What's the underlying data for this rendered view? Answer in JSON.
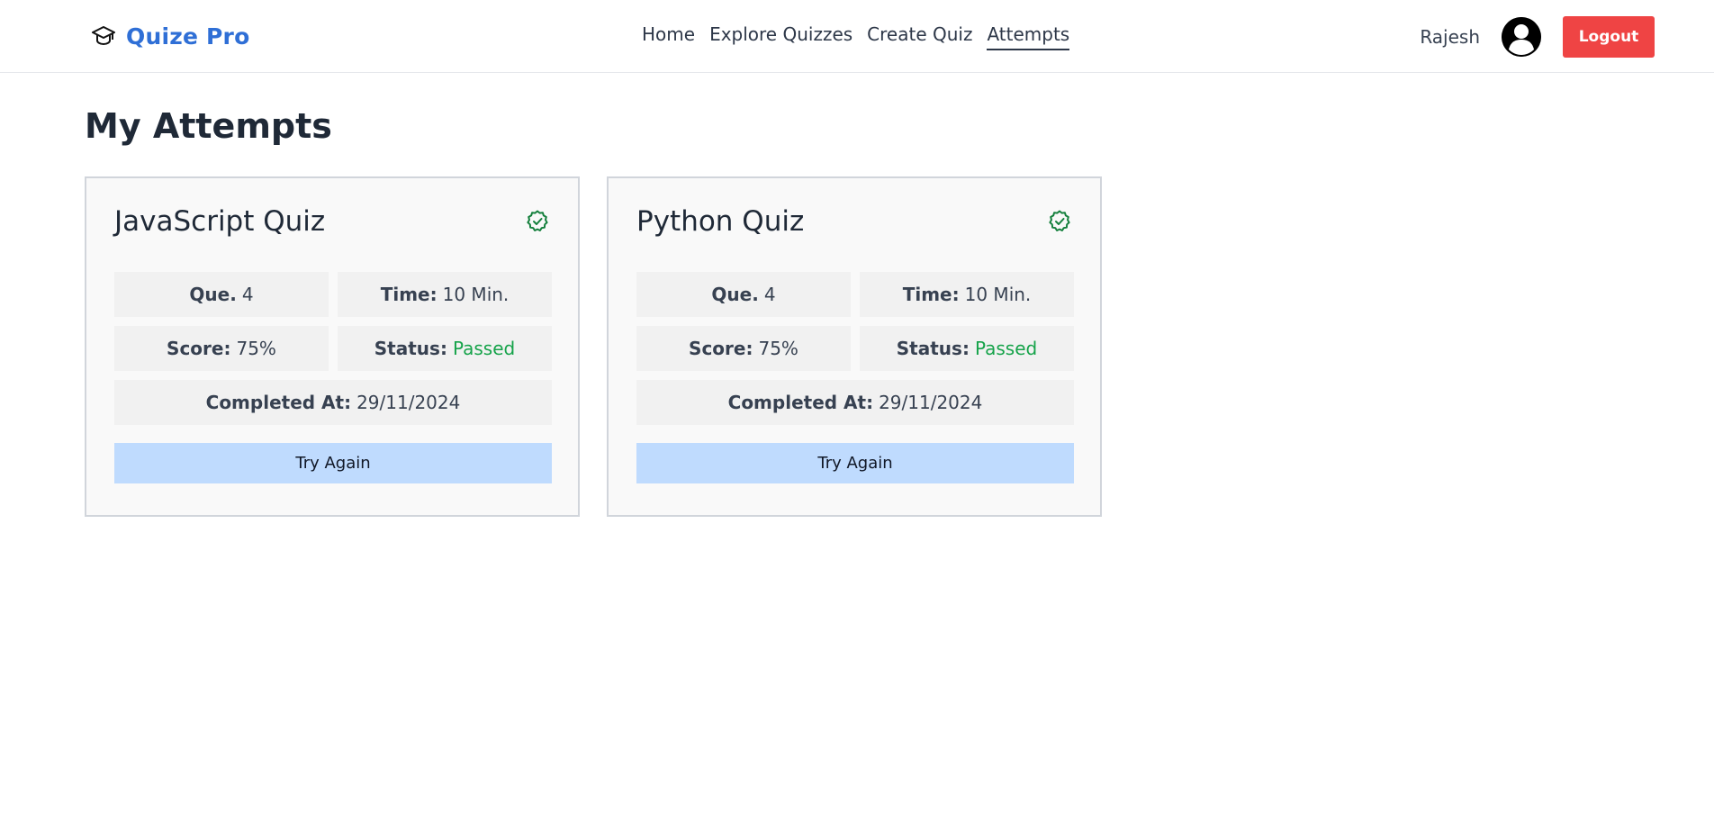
{
  "brand": {
    "name": "Quize Pro",
    "icon": "graduation-cap-icon",
    "color": "#2f6fd6"
  },
  "nav": {
    "links": [
      {
        "label": "Home",
        "active": false
      },
      {
        "label": "Explore Quizzes",
        "active": false
      },
      {
        "label": "Create Quiz",
        "active": false
      },
      {
        "label": "Attempts",
        "active": true
      }
    ]
  },
  "user": {
    "name": "Rajesh",
    "avatar_icon": "user-circle-icon",
    "logout_label": "Logout"
  },
  "page": {
    "title": "My Attempts"
  },
  "attempts": [
    {
      "title": "JavaScript Quiz",
      "status_icon": "badge-check-icon",
      "questions_label": "Que.",
      "questions_value": "4",
      "time_label": "Time:",
      "time_value": "10 Min.",
      "score_label": "Score:",
      "score_value": "75%",
      "status_label": "Status:",
      "status_value": "Passed",
      "completed_label": "Completed At:",
      "completed_value": "29/11/2024",
      "button_label": "Try Again"
    },
    {
      "title": "Python Quiz",
      "status_icon": "badge-check-icon",
      "questions_label": "Que.",
      "questions_value": "4",
      "time_label": "Time:",
      "time_value": "10 Min.",
      "score_label": "Score:",
      "score_value": "75%",
      "status_label": "Status:",
      "status_value": "Passed",
      "completed_label": "Completed At:",
      "completed_value": "29/11/2024",
      "button_label": "Try Again"
    }
  ],
  "colors": {
    "logout": "#ef4444",
    "passed": "#16a34a",
    "try_again": "#bfdbfe"
  }
}
